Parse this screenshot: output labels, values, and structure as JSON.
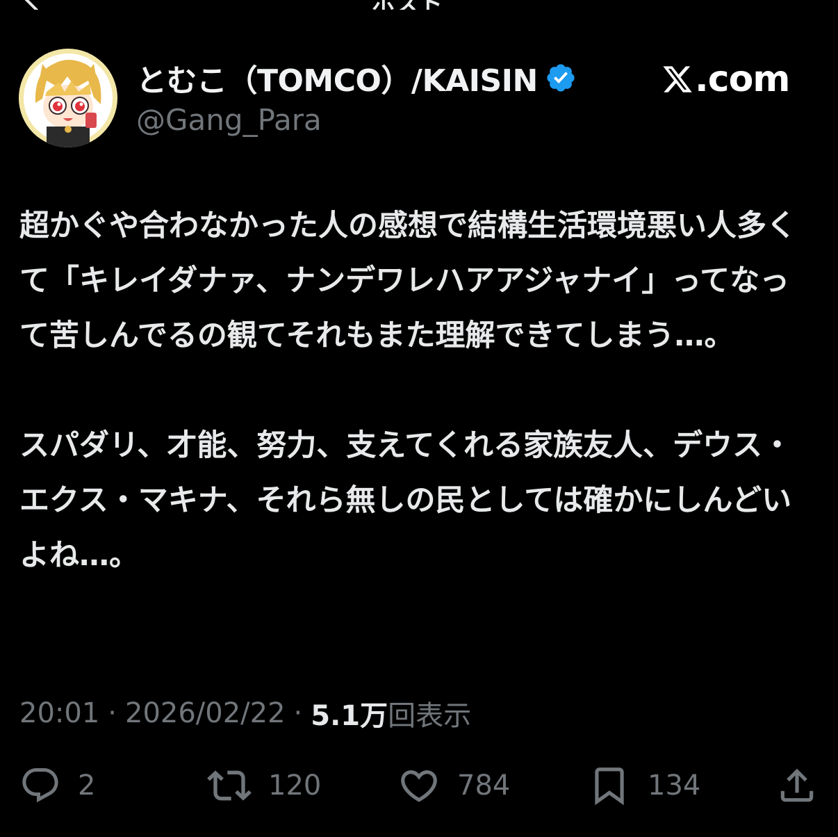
{
  "header": {
    "title_partial": "ポスト"
  },
  "author": {
    "display_name": "とむこ（TOMCO）/KAISIN",
    "handle": "@Gang_Para",
    "verified": true,
    "avatar": "avatar-anime-girl"
  },
  "watermark": {
    "logo_icon": "x-logo-icon",
    "text": ".com"
  },
  "tweet": {
    "paragraphs": [
      "超かぐや合わなかった人の感想で結構生活環境悪い人多くて「キレイダナァ、ナンデワレハアアジャナイ」ってなって苦しんでるの観てそれもまた理解できてしまう…。",
      "スパダリ、才能、努力、支えてくれる家族友人、デウス・エクス・マキナ、それら無しの民としては確かにしんどいよね…。"
    ]
  },
  "meta": {
    "time": "20:01",
    "date": "2026/02/22",
    "views_count": "5.1万",
    "views_label": "回表示",
    "separator": "·"
  },
  "actions": {
    "reply": {
      "icon": "reply-icon",
      "count": "2"
    },
    "retweet": {
      "icon": "retweet-icon",
      "count": "120"
    },
    "like": {
      "icon": "heart-icon",
      "count": "784"
    },
    "bookmark": {
      "icon": "bookmark-icon",
      "count": "134"
    },
    "share": {
      "icon": "share-icon"
    }
  },
  "colors": {
    "background": "#000000",
    "text_primary": "#e7e9ea",
    "text_secondary": "#71767b",
    "verified_blue": "#1d9bf0"
  }
}
